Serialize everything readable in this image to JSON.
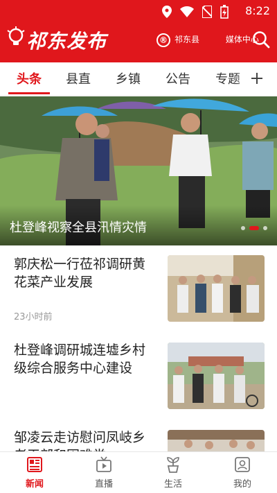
{
  "status_bar": {
    "time": "8:22"
  },
  "header": {
    "app_title": "祁东发布",
    "brand_name": "祁东县",
    "brand_mark": "®",
    "brand_suffix": "媒体中心"
  },
  "tabs": [
    {
      "label": "头条",
      "active": true
    },
    {
      "label": "县直",
      "active": false
    },
    {
      "label": "乡镇",
      "active": false
    },
    {
      "label": "公告",
      "active": false
    },
    {
      "label": "专题",
      "active": false
    }
  ],
  "hero": {
    "title": "杜登峰视察全县汛情灾情",
    "slides": 3,
    "active_slide": 2
  },
  "news": [
    {
      "title": "郭庆松一行莅祁调研黄花菜产业发展",
      "time": "23小时前"
    },
    {
      "title": "杜登峰调研城连墟乡村级综合服务中心建设",
      "time": ""
    },
    {
      "title": "邹凌云走访慰问凤岐乡老干部和困难党",
      "time": ""
    }
  ],
  "bottom_nav": [
    {
      "label": "新闻",
      "icon": "news-icon",
      "active": true
    },
    {
      "label": "直播",
      "icon": "tv-icon",
      "active": false
    },
    {
      "label": "生活",
      "icon": "sprout-icon",
      "active": false
    },
    {
      "label": "我的",
      "icon": "profile-icon",
      "active": false
    }
  ],
  "colors": {
    "brand_red": "#e0171c"
  }
}
